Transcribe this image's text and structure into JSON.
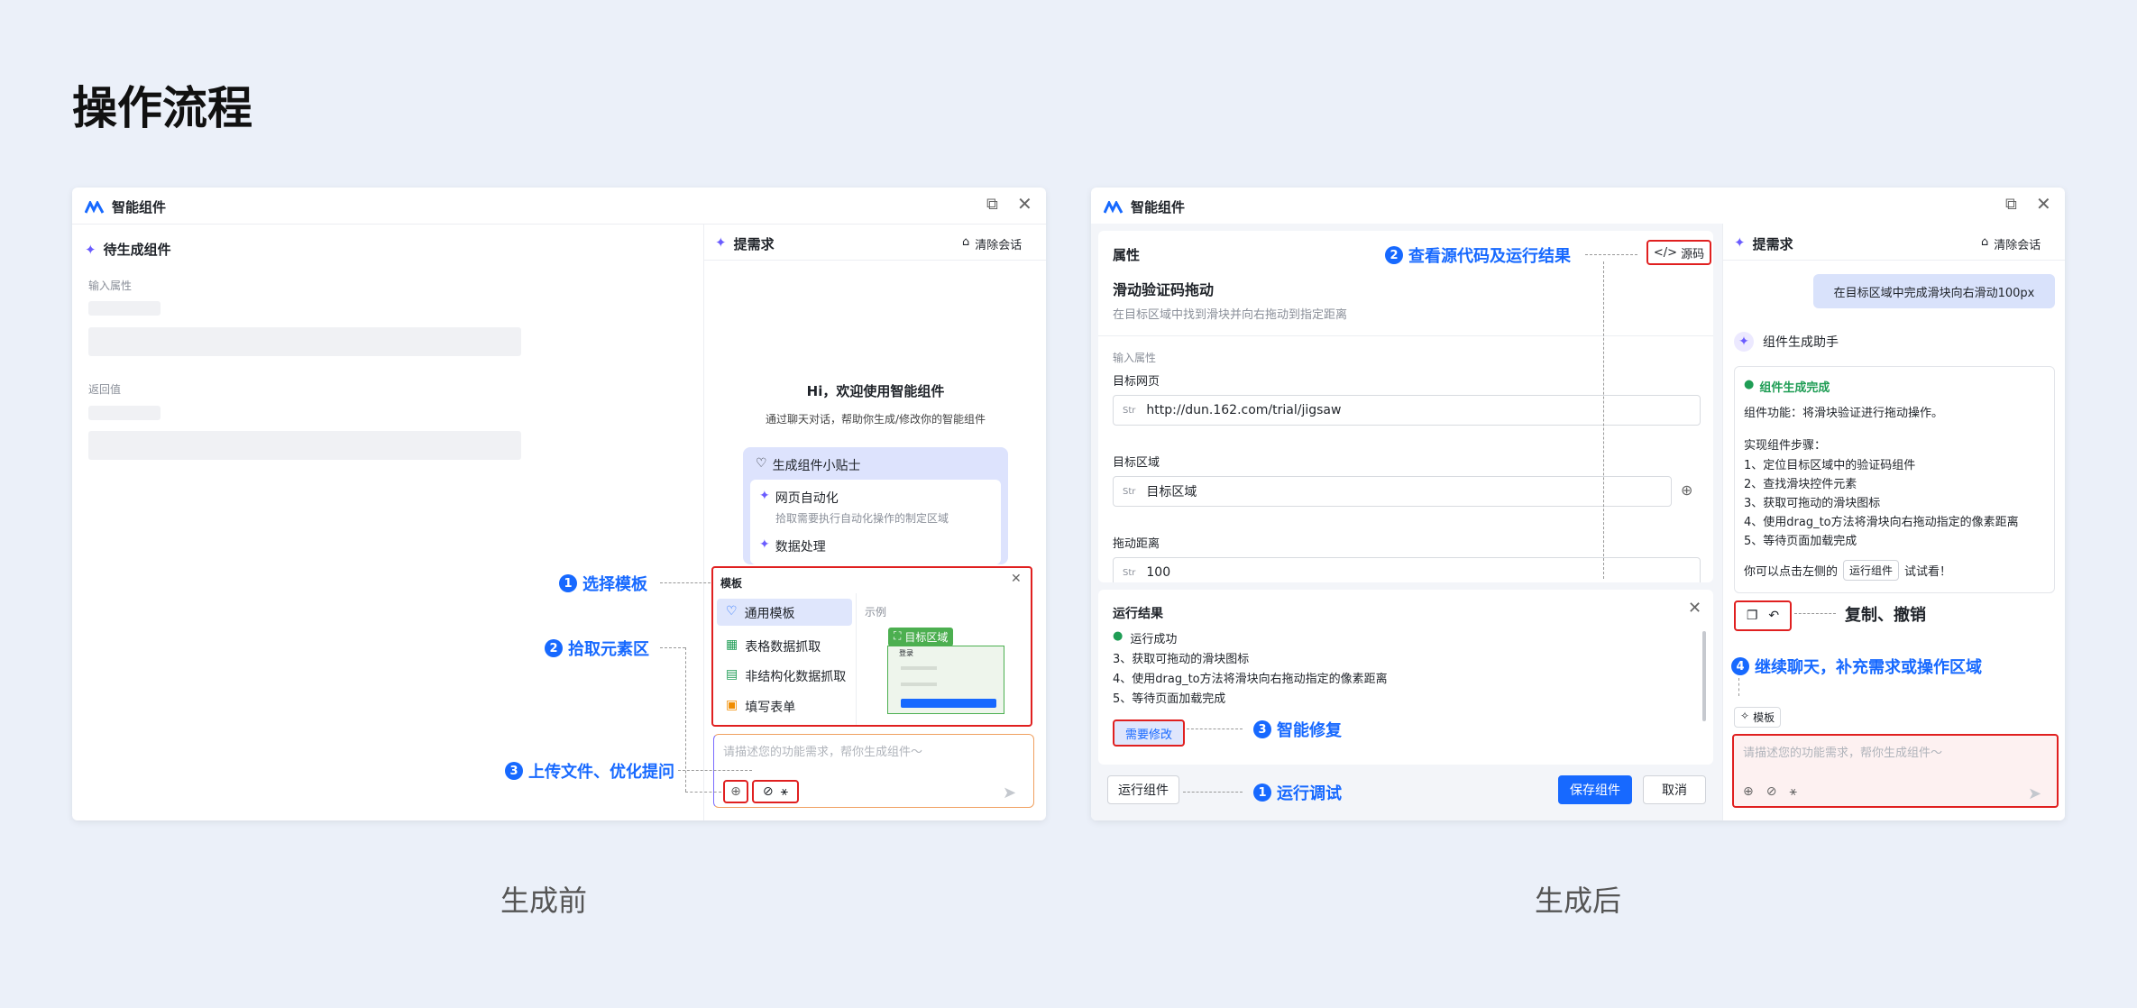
{
  "page": {
    "title": "操作流程",
    "caption_before": "生成前",
    "caption_after": "生成后"
  },
  "window": {
    "title": "智能组件"
  },
  "before": {
    "left_title": "待生成组件",
    "input_label": "输入属性",
    "return_label": "返回值",
    "right_title": "提需求",
    "clear_label": "清除会话",
    "welcome_title": "Hi，欢迎使用智能组件",
    "welcome_sub": "通过聊天对话，帮助你生成/修改你的智能组件",
    "tips_title": "生成组件小贴士",
    "tips": [
      {
        "title": "网页自动化",
        "desc": "拾取需要执行自动化操作的制定区域"
      },
      {
        "title": "数据处理",
        "desc": ""
      }
    ],
    "template": {
      "title": "模板",
      "items": [
        "通用模板",
        "表格数据抓取",
        "非结构化数据抓取",
        "填写表单"
      ],
      "example_label": "示例",
      "badge": "目标区域",
      "mini_title": "登录"
    },
    "input_placeholder": "请描述您的功能需求，帮你生成组件～"
  },
  "after": {
    "prop_title": "属性",
    "source_label": "源码",
    "comp_name": "滑动验证码拖动",
    "comp_desc": "在目标区域中找到滑块并向右拖动到指定距离",
    "input_label": "输入属性",
    "fields": [
      {
        "label": "目标网页",
        "value": "http://dun.162.com/trial/jigsaw"
      },
      {
        "label": "目标区域",
        "value": "目标区域"
      },
      {
        "label": "拖动距离",
        "value": "100"
      }
    ],
    "str_tag": "Str",
    "result_title": "运行结果",
    "result_success": "运行成功",
    "result_lines": [
      "3、获取可拖动的滑块图标",
      "4、使用drag_to方法将滑块向右拖动指定的像素距离",
      "5、等待页面加载完成"
    ],
    "fix_button": "需要修改",
    "run_button": "运行组件",
    "save_button": "保存组件",
    "cancel_button": "取消",
    "right_title": "提需求",
    "clear_label": "清除会话",
    "user_msg": "在目标区域中完成滑块向右滑动100px",
    "assistant_name": "组件生成助手",
    "done_title": "组件生成完成",
    "func_line": "组件功能：将滑块验证进行拖动操作。",
    "steps_title": "实现组件步骤：",
    "steps": [
      "1、定位目标区域中的验证码组件",
      "2、查找滑块控件元素",
      "3、获取可拖动的滑块图标",
      "4、使用drag_to方法将滑块向右拖动指定的像素距离",
      "5、等待页面加载完成"
    ],
    "try_prefix": "你可以点击左侧的",
    "try_chip": "运行组件",
    "try_suffix": "试试看！",
    "template_chip": "模板",
    "input_placeholder": "请描述您的功能需求，帮你生成组件～"
  },
  "annotations": {
    "b1": {
      "num": "1",
      "text": "选择模板"
    },
    "b2": {
      "num": "2",
      "text": "拾取元素区"
    },
    "b3": {
      "num": "3",
      "text": "上传文件、优化提问"
    },
    "a1": {
      "num": "1",
      "text": "运行调试"
    },
    "a2": {
      "num": "2",
      "text": "查看源代码及运行结果"
    },
    "a3": {
      "num": "3",
      "text": "智能修复"
    },
    "a4": {
      "num": "4",
      "text": "继续聊天，补充需求或操作区域"
    },
    "copy_undo": "复制、撤销"
  },
  "colors": {
    "accent": "#1769ff",
    "highlight": "#e02020",
    "success": "#1f9d55",
    "background": "#ebf0f9"
  }
}
